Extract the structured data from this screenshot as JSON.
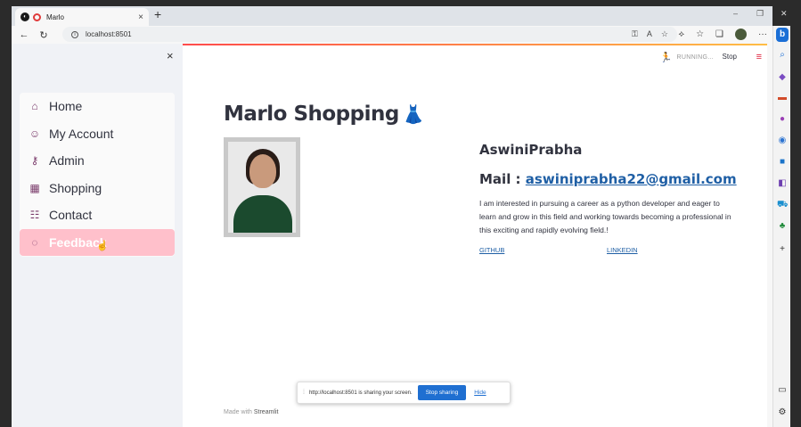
{
  "browser": {
    "tab_title": "Marlo",
    "tab_close": "×",
    "new_tab": "+",
    "url": "localhost:8501",
    "win_min": "–",
    "win_max": "❐",
    "win_close": "✕"
  },
  "sidebar": {
    "close": "×",
    "items": [
      {
        "label": "Home",
        "icon": "house-icon",
        "glyph": "⌂"
      },
      {
        "label": "My Account",
        "icon": "person-icon",
        "glyph": "☺"
      },
      {
        "label": "Admin",
        "icon": "key-icon",
        "glyph": "⚷"
      },
      {
        "label": "Shopping",
        "icon": "shop-icon",
        "glyph": "▦"
      },
      {
        "label": "Contact",
        "icon": "contact-card-icon",
        "glyph": "☷"
      },
      {
        "label": "Feedback",
        "icon": "chat-bubble-icon",
        "glyph": "💬"
      }
    ],
    "active_index": 5,
    "active_color": "#ffc0cb"
  },
  "header": {
    "running_text": "RUNNING...",
    "stop_label": "Stop",
    "menu_glyph": "≡"
  },
  "main": {
    "title": "Marlo Shopping",
    "title_emoji": "👗",
    "name": "AswiniPrabha",
    "mail_label": "Mail : ",
    "mail_address": "aswiniprabha22@gmail.com",
    "bio": "I am interested in pursuing a career as a python developer and eager to learn and grow in this field and working towards becoming a professional in this exciting and rapidly evolving field.!",
    "github_label": "GITHUB",
    "linkedin_label": "LINKEDIN"
  },
  "footer": {
    "made_with": "Made with ",
    "brand": "Streamlit"
  },
  "sharebar": {
    "message": "http://localhost:8501 is sharing your screen.",
    "stop_label": "Stop sharing",
    "hide_label": "Hide"
  },
  "colors": {
    "accent": "#ff4b4b",
    "link": "#1f5fa5",
    "share_button": "#1f6fd1"
  }
}
